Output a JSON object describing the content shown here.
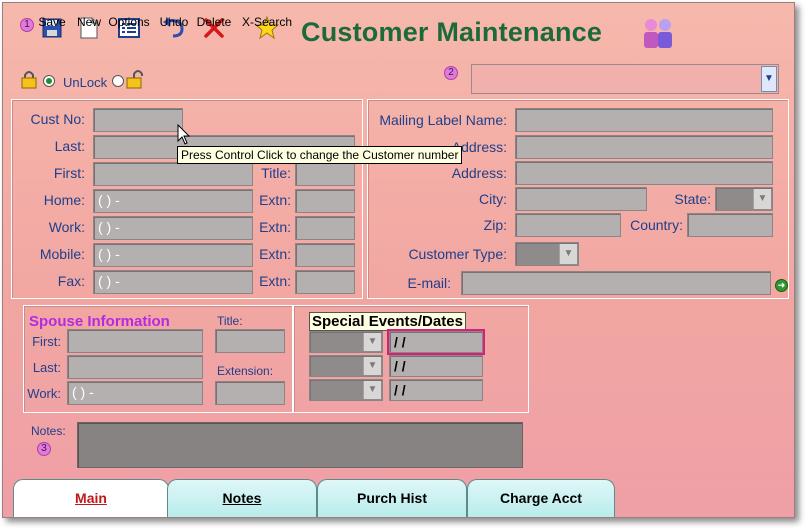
{
  "window": {
    "title": "Customer Maintenance"
  },
  "toolbar": {
    "marker1": "1",
    "buttons": [
      {
        "label": "Save",
        "icon": "save-disk-icon"
      },
      {
        "label": "New",
        "icon": "new-document-icon"
      },
      {
        "label": "Options",
        "icon": "options-list-icon"
      },
      {
        "label": "Undo",
        "icon": "undo-arrow-icon"
      },
      {
        "label": "Delete",
        "icon": "delete-x-icon"
      },
      {
        "label": "X-Search",
        "icon": "search-star-icon"
      }
    ]
  },
  "lock": {
    "unlock_label": "UnLock"
  },
  "marker2": "2",
  "marker3": "3",
  "customer": {
    "cust_no_label": "Cust No:",
    "last_label": "Last:",
    "first_label": "First:",
    "title_label": "Title:",
    "home_label": "Home:",
    "work_label": "Work:",
    "mobile_label": "Mobile:",
    "fax_label": "Fax:",
    "extn_label": "Extn:",
    "phone_placeholder": "(   )    -"
  },
  "tooltip": "Press Control Click to change the Customer number",
  "mailing": {
    "label_name": "Mailing Label Name:",
    "address1_label": "Address:",
    "address2_label": "Address:",
    "city_label": "City:",
    "state_label": "State:",
    "zip_label": "Zip:",
    "country_label": "Country:",
    "customer_type_label": "Customer Type:",
    "email_label": "E-mail:"
  },
  "spouse": {
    "section_title": "Spouse Information",
    "first_label": "First:",
    "last_label": "Last:",
    "work_label": "Work:",
    "title_label": "Title:",
    "extension_label": "Extension:",
    "phone_placeholder": "(   )    -"
  },
  "special_events": {
    "section_title": "Special Events/Dates",
    "dates": [
      "/ /",
      "/ /",
      "/ /"
    ]
  },
  "notes": {
    "label": "Notes:"
  },
  "tabs": [
    {
      "label": "Main",
      "active": true
    },
    {
      "label": "Notes",
      "active": false
    },
    {
      "label": "Purch Hist",
      "active": false
    },
    {
      "label": "Charge Acct",
      "active": false
    }
  ],
  "colors": {
    "title": "#1c6a3a",
    "label": "#1f3f8c",
    "spouse_title": "#b42be0",
    "background": "#f2a7a2"
  }
}
